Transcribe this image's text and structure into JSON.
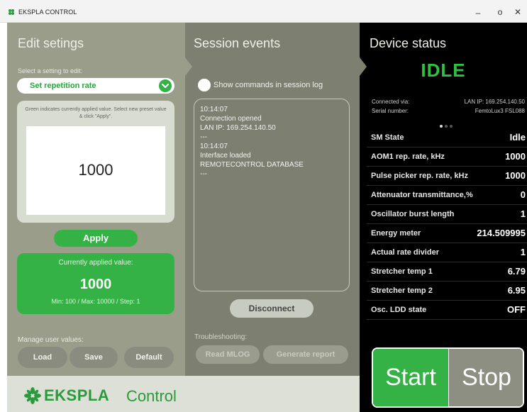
{
  "window": {
    "title": "EKSPLA CONTROL",
    "min_glyph": "–",
    "max_glyph": "o",
    "close_glyph": "✕"
  },
  "left": {
    "heading": "Edit setings",
    "select_label": "Select a setting to edit:",
    "selected_setting": "Set repetition rate",
    "hint": "Green indicates currently applied value. Select new preset value & click \"Apply\".",
    "preset_value": "1000",
    "apply_label": "Apply",
    "current": {
      "title": "Currently applied value:",
      "value": "1000",
      "range": "Min: 100 / Max: 10000 / Step: 1"
    },
    "manage_label": "Manage user values:",
    "load_label": "Load",
    "save_label": "Save",
    "default_label": "Default"
  },
  "middle": {
    "heading": "Session events",
    "show_commands_label": "Show commands in session log",
    "log_lines": [
      "10:14:07",
      "Connection opened",
      "LAN IP: 169.254.140.50",
      "---",
      "10:14:07",
      "Interface loaded",
      "REMOTECONTROL DATABASE",
      "---"
    ],
    "disconnect_label": "Disconnect",
    "troubleshooting_label": "Troubleshooting:",
    "read_mlog_label": "Read MLOG",
    "generate_report_label": "Generate report"
  },
  "right": {
    "heading": "Device status",
    "state": "IDLE",
    "connected_via_label": "Connected via:",
    "connected_via_value": "LAN IP: 169.254.140.50",
    "serial_label": "Serial number:",
    "serial_value": "FemtoLux3 FSL088",
    "rows": [
      {
        "label": "SM State",
        "value": "Idle"
      },
      {
        "label": "AOM1 rep. rate, kHz",
        "value": "1000"
      },
      {
        "label": "Pulse picker rep. rate, kHz",
        "value": "1000"
      },
      {
        "label": "Attenuator transmittance,%",
        "value": "0"
      },
      {
        "label": "Oscillator burst length",
        "value": "1"
      },
      {
        "label": "Energy meter",
        "value": "214.509995"
      },
      {
        "label": "Actual rate divider",
        "value": "1"
      },
      {
        "label": "Stretcher temp 1",
        "value": "6.79"
      },
      {
        "label": "Stretcher temp 2",
        "value": "6.95"
      },
      {
        "label": "Osc. LDD state",
        "value": "OFF"
      }
    ],
    "start_label": "Start",
    "stop_label": "Stop"
  },
  "footer": {
    "brand": "EKSPLA",
    "product": "Control"
  },
  "colors": {
    "accent_green": "#34b245",
    "idle_green": "#2dc23f",
    "left_panel": "#999d8a",
    "mid_panel": "#7d7f71",
    "right_panel": "#000000"
  },
  "icons": {
    "app": "ekspla-logo-icon",
    "chevron": "chevron-down-icon"
  }
}
